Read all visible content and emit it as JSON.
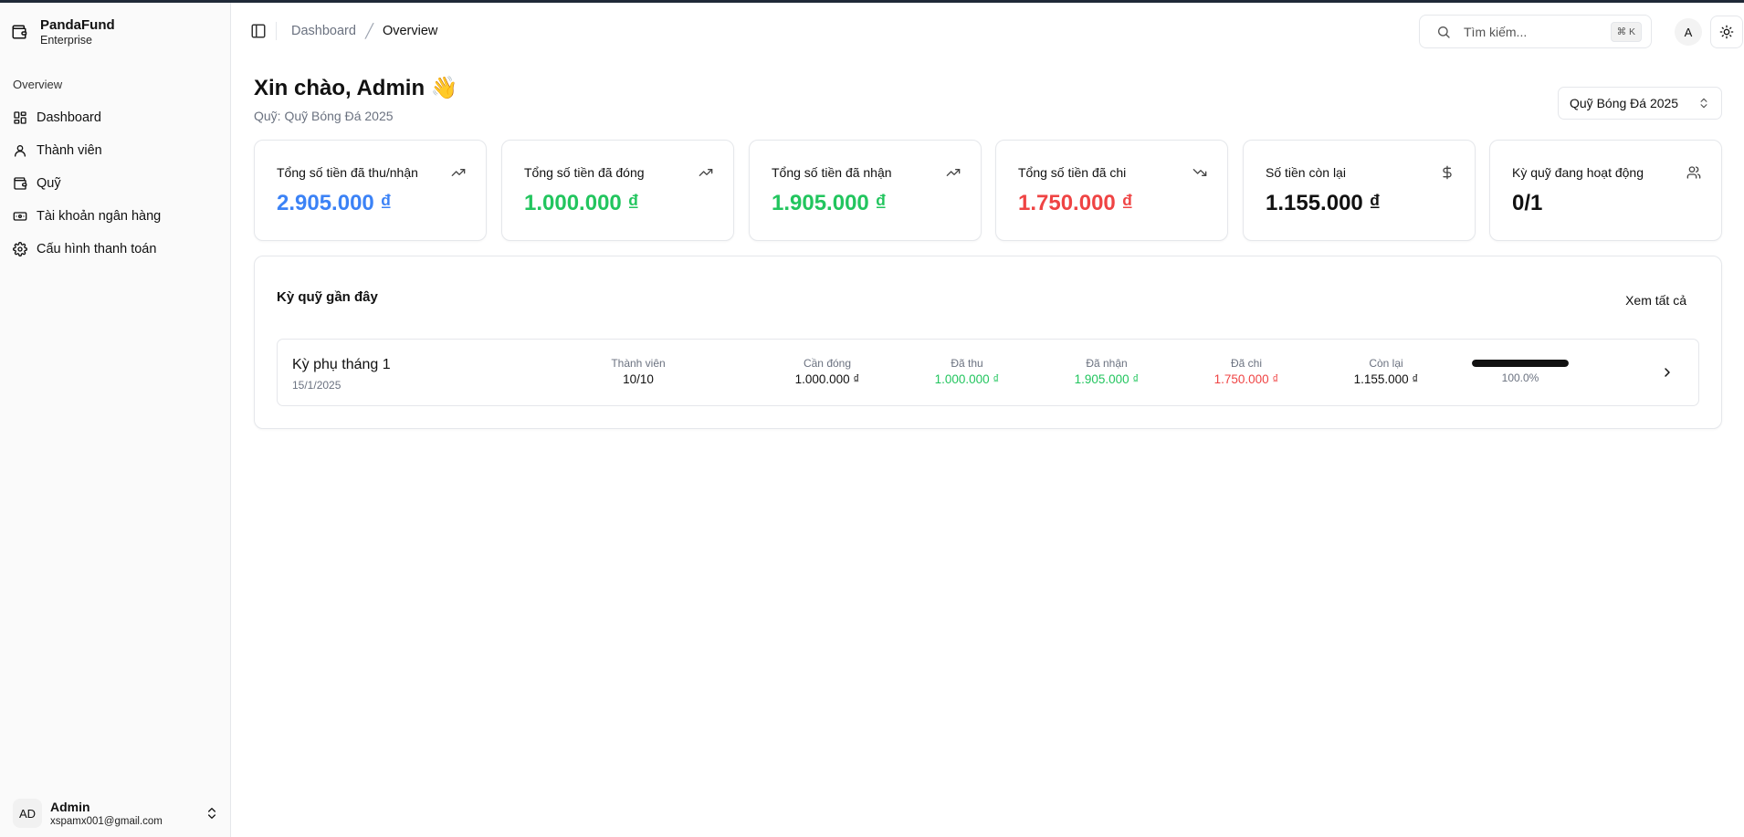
{
  "brand": {
    "name": "PandaFund",
    "subtitle": "Enterprise"
  },
  "sidebar": {
    "group_label": "Overview",
    "items": [
      {
        "label": "Dashboard",
        "icon": "dashboard-icon"
      },
      {
        "label": "Thành viên",
        "icon": "user-icon"
      },
      {
        "label": "Quỹ",
        "icon": "wallet-icon"
      },
      {
        "label": "Tài khoản ngân hàng",
        "icon": "banknote-icon"
      },
      {
        "label": "Cấu hình thanh toán",
        "icon": "gear-icon"
      }
    ]
  },
  "user": {
    "initials": "AD",
    "name": "Admin",
    "email": "xspamx001@gmail.com"
  },
  "header": {
    "breadcrumb": [
      "Dashboard",
      "Overview"
    ],
    "search_placeholder": "Tìm kiếm...",
    "search_shortcut": "⌘ K",
    "avatar_initial": "A"
  },
  "main": {
    "greeting": "Xin chào, Admin 👋",
    "fund_line": "Quỹ: Quỹ Bóng Đá 2025",
    "fund_select_value": "Quỹ Bóng Đá 2025",
    "cards": [
      {
        "title": "Tổng số tiền đã thu/nhận",
        "value": "2.905.000 ₫",
        "icon": "trending-up-icon",
        "color": "#3b82f6"
      },
      {
        "title": "Tổng số tiền đã đóng",
        "value": "1.000.000 ₫",
        "icon": "trending-up-icon",
        "color": "#22c55e"
      },
      {
        "title": "Tổng số tiền đã nhận",
        "value": "1.905.000 ₫",
        "icon": "trending-up-icon",
        "color": "#22c55e"
      },
      {
        "title": "Tổng số tiền đã chi",
        "value": "1.750.000 ₫",
        "icon": "trending-down-icon",
        "color": "#ef4444"
      },
      {
        "title": "Số tiền còn lại",
        "value": "1.155.000 ₫",
        "icon": "dollar-icon",
        "color": "#111111"
      },
      {
        "title": "Kỳ quỹ đang hoạt động",
        "value": "0/1",
        "icon": "users-icon",
        "color": "#111111"
      }
    ],
    "recent": {
      "title": "Kỳ quỹ gần đây",
      "view_all": "Xem tất cả",
      "rows": [
        {
          "name": "Kỳ phụ tháng 1",
          "date": "15/1/2025",
          "members_label": "Thành viên",
          "members": "10/10",
          "due_label": "Cần đóng",
          "due": "1.000.000 ₫",
          "collected_label": "Đã thu",
          "collected": "1.000.000 ₫",
          "received_label": "Đã nhận",
          "received": "1.905.000 ₫",
          "spent_label": "Đã chi",
          "spent": "1.750.000 ₫",
          "remaining_label": "Còn lại",
          "remaining": "1.155.000 ₫",
          "progress": 1.0,
          "progress_label": "100.0%"
        }
      ]
    }
  },
  "colors": {
    "blue": "#3b82f6",
    "green": "#22c55e",
    "red": "#ef4444"
  }
}
